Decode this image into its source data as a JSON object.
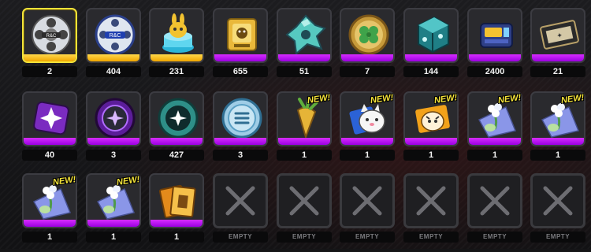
{
  "inventory": {
    "rows": [
      [
        {
          "count": "2",
          "bar": "gold",
          "icon": "film-reel-icon",
          "selected": true
        },
        {
          "count": "404",
          "bar": "gold",
          "icon": "blue-film-reel-icon"
        },
        {
          "count": "231",
          "bar": "gold",
          "icon": "bunny-trophy-icon"
        },
        {
          "count": "655",
          "bar": "purple",
          "icon": "gold-cube-icon"
        },
        {
          "count": "51",
          "bar": "purple",
          "icon": "teal-gear-shard-icon"
        },
        {
          "count": "7",
          "bar": "purple",
          "icon": "clover-coin-icon"
        },
        {
          "count": "144",
          "bar": "purple",
          "icon": "teal-die-icon"
        },
        {
          "count": "2400",
          "bar": "purple",
          "icon": "battery-chip-icon"
        },
        {
          "count": "21",
          "bar": "purple",
          "icon": "dark-ticket-icon"
        }
      ],
      [
        {
          "count": "40",
          "bar": "purple",
          "icon": "star-chip-icon"
        },
        {
          "count": "3",
          "bar": "purple",
          "icon": "purple-coin-icon"
        },
        {
          "count": "427",
          "bar": "purple",
          "icon": "teal-cog-coin-icon"
        },
        {
          "count": "3",
          "bar": "purple",
          "icon": "silver-coin-icon"
        },
        {
          "count": "1",
          "bar": "purple",
          "icon": "carrot-icon",
          "new": "NEW!"
        },
        {
          "count": "1",
          "bar": "purple",
          "icon": "cat-card-icon",
          "new": "NEW!"
        },
        {
          "count": "1",
          "bar": "purple",
          "icon": "tiger-card-icon",
          "new": "NEW!"
        },
        {
          "count": "1",
          "bar": "purple",
          "icon": "flower-card-icon",
          "new": "NEW!"
        },
        {
          "count": "1",
          "bar": "purple",
          "icon": "flower-card-icon",
          "new": "NEW!"
        }
      ],
      [
        {
          "count": "1",
          "bar": "purple",
          "icon": "flower-card-icon",
          "new": "NEW!"
        },
        {
          "count": "1",
          "bar": "purple",
          "icon": "flower-card-icon",
          "new": "NEW!"
        },
        {
          "count": "1",
          "bar": "purple",
          "icon": "orange-tickets-icon"
        },
        {
          "empty": true,
          "label": "EMPTY"
        },
        {
          "empty": true,
          "label": "EMPTY"
        },
        {
          "empty": true,
          "label": "EMPTY"
        },
        {
          "empty": true,
          "label": "EMPTY"
        },
        {
          "empty": true,
          "label": "EMPTY"
        },
        {
          "empty": true,
          "label": "EMPTY"
        }
      ]
    ]
  },
  "colors": {
    "selected_border": "#f2e33a",
    "gold_bar": "#f0a600",
    "purple_bar": "#b000ff",
    "new_badge": "#f5e43a"
  }
}
